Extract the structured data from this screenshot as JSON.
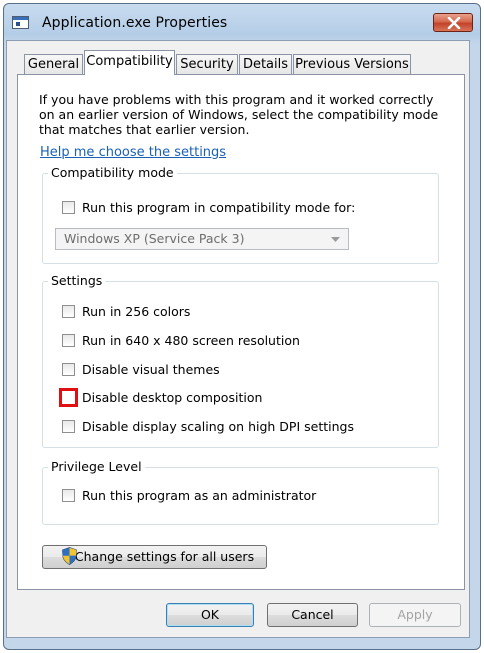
{
  "window": {
    "title": "Application.exe Properties"
  },
  "tabs": [
    {
      "label": "General"
    },
    {
      "label": "Compatibility"
    },
    {
      "label": "Security"
    },
    {
      "label": "Details"
    },
    {
      "label": "Previous Versions"
    }
  ],
  "intro": {
    "text": "If you have problems with this program and it worked correctly on an earlier version of Windows, select the compatibility mode that matches that earlier version.",
    "help_link": "Help me choose the settings"
  },
  "compatibility_mode": {
    "group_label": "Compatibility mode",
    "checkbox_label": "Run this program in compatibility mode for:",
    "checked": false,
    "selected_os": "Windows XP (Service Pack 3)"
  },
  "settings": {
    "group_label": "Settings",
    "options": [
      {
        "label": "Run in 256 colors",
        "checked": false
      },
      {
        "label": "Run in 640 x 480 screen resolution",
        "checked": false
      },
      {
        "label": "Disable visual themes",
        "checked": false
      },
      {
        "label": "Disable desktop composition",
        "checked": false,
        "highlighted": true
      },
      {
        "label": "Disable display scaling on high DPI settings",
        "checked": false
      }
    ]
  },
  "privilege": {
    "group_label": "Privilege Level",
    "checkbox_label": "Run this program as an administrator",
    "checked": false
  },
  "buttons": {
    "change_all_users": "Change settings for all users",
    "ok": "OK",
    "cancel": "Cancel",
    "apply": "Apply"
  },
  "colors": {
    "highlight": "#e01010",
    "link": "#1a60b5",
    "close_button": "#c1432a"
  },
  "icons": [
    "app-icon",
    "close-icon",
    "uac-shield-icon",
    "dropdown-arrow-icon"
  ]
}
